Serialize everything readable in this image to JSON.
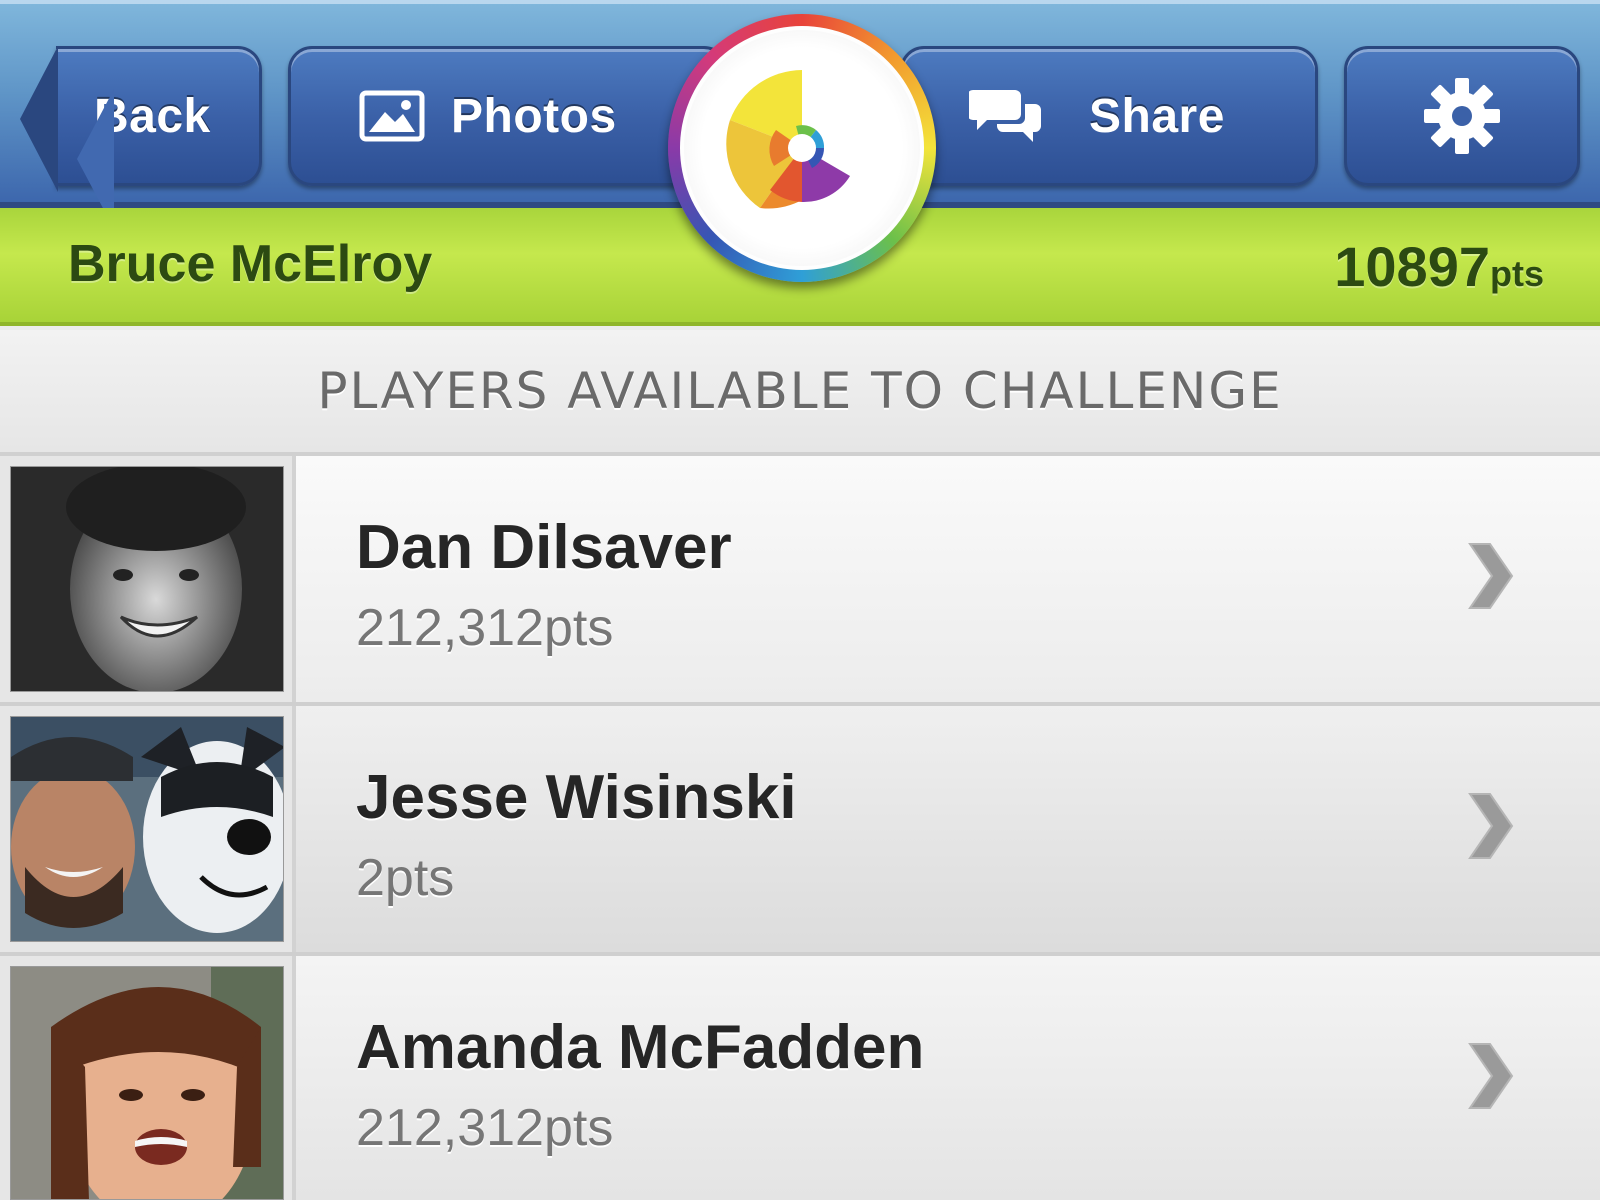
{
  "nav": {
    "back_label": "Back",
    "photos_label": "Photos",
    "share_label": "Share",
    "icons": {
      "photos": "image-icon",
      "share": "chat-bubbles-icon",
      "settings": "gear-icon"
    }
  },
  "logo": {
    "icon": "color-wheel-logo"
  },
  "user": {
    "name": "Bruce McElroy",
    "score": "10897",
    "score_unit": "pts"
  },
  "section": {
    "title": "PLAYERS AVAILABLE TO CHALLENGE"
  },
  "players": [
    {
      "name": "Dan Dilsaver",
      "points": "212,312pts"
    },
    {
      "name": "Jesse Wisinski",
      "points": "2pts"
    },
    {
      "name": "Amanda McFadden",
      "points": "212,312pts"
    }
  ],
  "colors": {
    "nav_blue": "#3d67ad",
    "accent_green": "#c5e84d",
    "text_dark": "#262626",
    "text_muted": "#767676"
  }
}
